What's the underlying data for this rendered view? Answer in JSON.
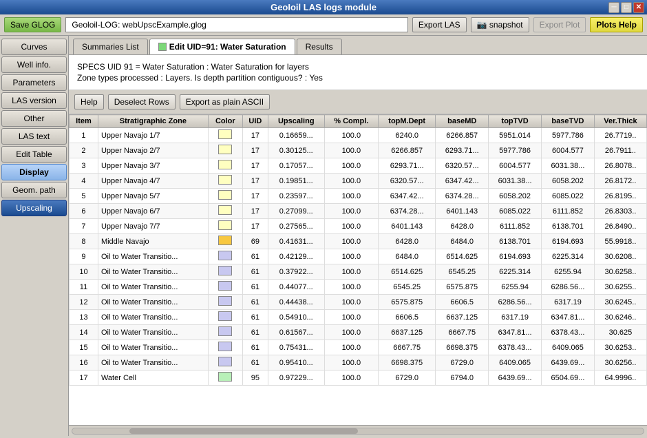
{
  "window": {
    "title": "GeoIoil LAS logs module",
    "controls": {
      "minimize": "─",
      "maximize": "□",
      "close": "✕"
    }
  },
  "toolbar": {
    "save_label": "Save GLOG",
    "file_label": "Geoloil-LOG: webUpscExample.glog",
    "export_las_label": "Export LAS",
    "snapshot_label": "snapshot",
    "export_plot_label": "Export Plot",
    "plots_help_label": "Plots Help"
  },
  "sidebar": {
    "items": [
      {
        "id": "curves",
        "label": "Curves",
        "active": false
      },
      {
        "id": "well-info",
        "label": "Well info.",
        "active": false
      },
      {
        "id": "parameters",
        "label": "Parameters",
        "active": false
      },
      {
        "id": "las-version",
        "label": "LAS version",
        "active": false
      },
      {
        "id": "other",
        "label": "Other",
        "active": false
      },
      {
        "id": "las-text",
        "label": "LAS text",
        "active": false
      },
      {
        "id": "edit-table",
        "label": "Edit Table",
        "active": false
      },
      {
        "id": "display",
        "label": "Display",
        "active": false
      },
      {
        "id": "geom-path",
        "label": "Geom. path",
        "active": false
      },
      {
        "id": "upscaling",
        "label": "Upscaling",
        "active": true
      }
    ]
  },
  "tabs": [
    {
      "id": "summaries-list",
      "label": "Summaries List",
      "active": false,
      "has_icon": false
    },
    {
      "id": "edit-uid",
      "label": "Edit UID=91: Water Saturation",
      "active": true,
      "has_icon": true,
      "icon_color": "#7cd878"
    },
    {
      "id": "results",
      "label": "Results",
      "active": false,
      "has_icon": false
    }
  ],
  "info": {
    "spec_line": "SPECS UID 91 = Water Saturation : Water Saturation for layers",
    "zone_line": "Zone types processed : Layers.   Is depth partition contiguous? : Yes"
  },
  "action_bar": {
    "help_label": "Help",
    "deselect_label": "Deselect Rows",
    "export_ascii_label": "Export as plain ASCII"
  },
  "table": {
    "columns": [
      "Item",
      "Stratigraphic Zone",
      "Color",
      "UID",
      "Upscaling",
      "% Compl.",
      "topM.Dept",
      "baseMD",
      "topTVD",
      "baseTVD",
      "Ver.Thick"
    ],
    "rows": [
      {
        "item": 1,
        "zone": "Upper Navajo 1/7",
        "color": "#ffffc0",
        "uid": 17,
        "upscaling": "0.16659...",
        "compl": "100.0",
        "topMD": "6240.0",
        "baseMD": "6266.857",
        "topTVD": "5951.014",
        "baseTVD": "5977.786",
        "thick": "26.7719..",
        "selected": false
      },
      {
        "item": 2,
        "zone": "Upper Navajo 2/7",
        "color": "#ffffc0",
        "uid": 17,
        "upscaling": "0.30125...",
        "compl": "100.0",
        "topMD": "6266.857",
        "baseMD": "6293.71...",
        "topTVD": "5977.786",
        "baseTVD": "6004.577",
        "thick": "26.7911..",
        "selected": false
      },
      {
        "item": 3,
        "zone": "Upper Navajo 3/7",
        "color": "#ffffc0",
        "uid": 17,
        "upscaling": "0.17057...",
        "compl": "100.0",
        "topMD": "6293.71...",
        "baseMD": "6320.57...",
        "topTVD": "6004.577",
        "baseTVD": "6031.38...",
        "thick": "26.8078..",
        "selected": false
      },
      {
        "item": 4,
        "zone": "Upper Navajo 4/7",
        "color": "#ffffc0",
        "uid": 17,
        "upscaling": "0.19851...",
        "compl": "100.0",
        "topMD": "6320.57...",
        "baseMD": "6347.42...",
        "topTVD": "6031.38...",
        "baseTVD": "6058.202",
        "thick": "26.8172..",
        "selected": false
      },
      {
        "item": 5,
        "zone": "Upper Navajo 5/7",
        "color": "#ffffc0",
        "uid": 17,
        "upscaling": "0.23597...",
        "compl": "100.0",
        "topMD": "6347.42...",
        "baseMD": "6374.28...",
        "topTVD": "6058.202",
        "baseTVD": "6085.022",
        "thick": "26.8195..",
        "selected": false
      },
      {
        "item": 6,
        "zone": "Upper Navajo 6/7",
        "color": "#ffffc0",
        "uid": 17,
        "upscaling": "0.27099...",
        "compl": "100.0",
        "topMD": "6374.28...",
        "baseMD": "6401.143",
        "topTVD": "6085.022",
        "baseTVD": "6111.852",
        "thick": "26.8303..",
        "selected": false
      },
      {
        "item": 7,
        "zone": "Upper Navajo 7/7",
        "color": "#ffffc0",
        "uid": 17,
        "upscaling": "0.27565...",
        "compl": "100.0",
        "topMD": "6401.143",
        "baseMD": "6428.0",
        "topTVD": "6111.852",
        "baseTVD": "6138.701",
        "thick": "26.8490..",
        "selected": false
      },
      {
        "item": 8,
        "zone": "Middle Navajo",
        "color": "#f8c840",
        "uid": 69,
        "upscaling": "0.41631...",
        "compl": "100.0",
        "topMD": "6428.0",
        "baseMD": "6484.0",
        "topTVD": "6138.701",
        "baseTVD": "6194.693",
        "thick": "55.9918..",
        "selected": false
      },
      {
        "item": 9,
        "zone": "Oil to Water Transitio...",
        "color": "#c8c8f0",
        "uid": 61,
        "upscaling": "0.42129...",
        "compl": "100.0",
        "topMD": "6484.0",
        "baseMD": "6514.625",
        "topTVD": "6194.693",
        "baseTVD": "6225.314",
        "thick": "30.6208..",
        "selected": false
      },
      {
        "item": 10,
        "zone": "Oil to Water Transitio...",
        "color": "#c8c8f0",
        "uid": 61,
        "upscaling": "0.37922...",
        "compl": "100.0",
        "topMD": "6514.625",
        "baseMD": "6545.25",
        "topTVD": "6225.314",
        "baseTVD": "6255.94",
        "thick": "30.6258..",
        "selected": false
      },
      {
        "item": 11,
        "zone": "Oil to Water Transitio...",
        "color": "#c8c8f0",
        "uid": 61,
        "upscaling": "0.44077...",
        "compl": "100.0",
        "topMD": "6545.25",
        "baseMD": "6575.875",
        "topTVD": "6255.94",
        "baseTVD": "6286.56...",
        "thick": "30.6255..",
        "selected": false
      },
      {
        "item": 12,
        "zone": "Oil to Water Transitio...",
        "color": "#c8c8f0",
        "uid": 61,
        "upscaling": "0.44438...",
        "compl": "100.0",
        "topMD": "6575.875",
        "baseMD": "6606.5",
        "topTVD": "6286.56...",
        "baseTVD": "6317.19",
        "thick": "30.6245..",
        "selected": false
      },
      {
        "item": 13,
        "zone": "Oil to Water Transitio...",
        "color": "#c8c8f0",
        "uid": 61,
        "upscaling": "0.54910...",
        "compl": "100.0",
        "topMD": "6606.5",
        "baseMD": "6637.125",
        "topTVD": "6317.19",
        "baseTVD": "6347.81...",
        "thick": "30.6246..",
        "selected": false
      },
      {
        "item": 14,
        "zone": "Oil to Water Transitio...",
        "color": "#c8c8f0",
        "uid": 61,
        "upscaling": "0.61567...",
        "compl": "100.0",
        "topMD": "6637.125",
        "baseMD": "6667.75",
        "topTVD": "6347.81...",
        "baseTVD": "6378.43...",
        "thick": "30.625",
        "selected": false
      },
      {
        "item": 15,
        "zone": "Oil to Water Transitio...",
        "color": "#c8c8f0",
        "uid": 61,
        "upscaling": "0.75431...",
        "compl": "100.0",
        "topMD": "6667.75",
        "baseMD": "6698.375",
        "topTVD": "6378.43...",
        "baseTVD": "6409.065",
        "thick": "30.6253..",
        "selected": false
      },
      {
        "item": 16,
        "zone": "Oil to Water Transitio...",
        "color": "#c8c8f0",
        "uid": 61,
        "upscaling": "0.95410...",
        "compl": "100.0",
        "topMD": "6698.375",
        "baseMD": "6729.0",
        "topTVD": "6409.065",
        "baseTVD": "6439.69...",
        "thick": "30.6256..",
        "selected": false
      },
      {
        "item": 17,
        "zone": "Water Cell",
        "color": "#b8f0b8",
        "uid": 95,
        "upscaling": "0.97229...",
        "compl": "100.0",
        "topMD": "6729.0",
        "baseMD": "6794.0",
        "topTVD": "6439.69...",
        "baseTVD": "6504.69...",
        "thick": "64.9996..",
        "selected": false
      }
    ]
  }
}
